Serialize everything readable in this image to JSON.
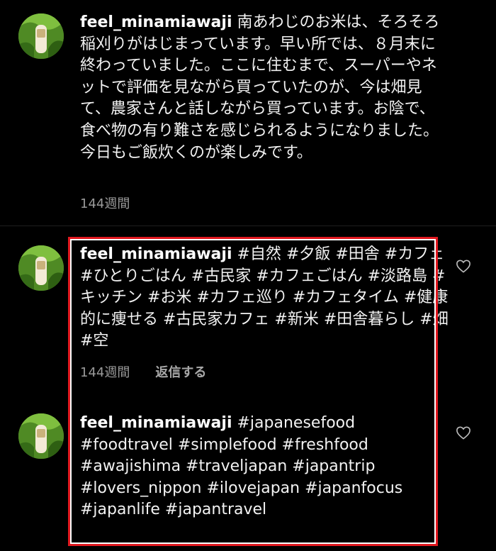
{
  "comments": [
    {
      "username": "feel_minamiawaji",
      "text": "南あわじのお米は、そろそろ稲刈りがはじまっています。早い所では、８月末に終わっていました。ここに住むまで、スーパーやネットで評価を見ながら買っていたのが、今は畑見て、農家さんと話しながら買っています。お陰で、食べ物の有り難さを感じられるようになりました。今日もご飯炊くのが楽しみです。",
      "time": "144週間"
    },
    {
      "username": "feel_minamiawaji",
      "text": "#自然 #夕飯 #田舎 #カフェ #ひとりごはん #古民家 #カフェごはん #淡路島 #キッチン #お米 #カフェ巡り #カフェタイム #健康的に痩せる #古民家カフェ #新米 #田舎暮らし #畑 #空",
      "time": "144週間",
      "reply_label": "返信する"
    },
    {
      "username": "feel_minamiawaji",
      "text": "#japanesefood #foodtravel #simplefood #freshfood #awajishima #traveljapan #japantrip #lovers_nippon #ilovejapan #japanfocus #japanlife #japantravel"
    }
  ],
  "icons": {
    "avatar": "avatar-image",
    "like": "heart-icon"
  },
  "colors": {
    "background": "#000000",
    "text": "#f2f2f2",
    "meta": "#9a9a9a",
    "highlight": "#e0181f"
  }
}
